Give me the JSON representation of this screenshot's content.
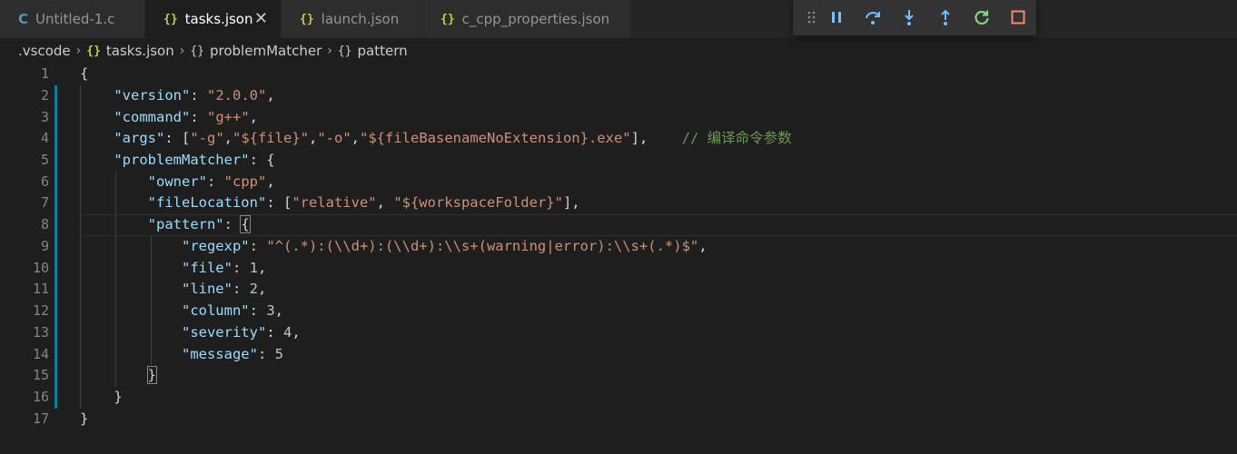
{
  "tabs": [
    {
      "icon": "C",
      "label": "Untitled-1.c"
    },
    {
      "icon": "{}",
      "label": "tasks.json",
      "close": "✕"
    },
    {
      "icon": "{}",
      "label": "launch.json"
    },
    {
      "icon": "{}",
      "label": "c_cpp_properties.json"
    }
  ],
  "debug_toolbar": {
    "icons": [
      "drag-handle-icon",
      "pause-icon",
      "step-over-icon",
      "step-into-icon",
      "step-out-icon",
      "restart-icon",
      "stop-icon"
    ],
    "colors": {
      "blue": "#75beff",
      "green": "#89d185",
      "red": "#f48771"
    }
  },
  "breadcrumb": {
    "folder": ".vscode",
    "file_icon": "{}",
    "file": "tasks.json",
    "obj_icon": "{}",
    "item1": "problemMatcher",
    "item2": "pattern",
    "separator": "›"
  },
  "editor": {
    "line_numbers": [
      "1",
      "2",
      "3",
      "4",
      "5",
      "6",
      "7",
      "8",
      "9",
      "10",
      "11",
      "12",
      "13",
      "14",
      "15",
      "16",
      "17"
    ],
    "lines": {
      "l1_brace": "{",
      "l2_key": "\"version\"",
      "l2_val": "\"2.0.0\"",
      "l3_key": "\"command\"",
      "l3_val": "\"g++\"",
      "l4_key": "\"args\"",
      "l4_a1": "\"-g\"",
      "l4_a2": "\"${file}\"",
      "l4_a3": "\"-o\"",
      "l4_a4": "\"${fileBasenameNoExtension}.exe\"",
      "l4_comment": "// 编译命令参数",
      "l5_key": "\"problemMatcher\"",
      "l6_key": "\"owner\"",
      "l6_val": "\"cpp\"",
      "l7_key": "\"fileLocation\"",
      "l7_a1": "\"relative\"",
      "l7_a2": "\"${workspaceFolder}\"",
      "l8_key": "\"pattern\"",
      "l9_key": "\"regexp\"",
      "l9_val": "\"^(.*):(\\\\d+):(\\\\d+):\\\\s+(warning|error):\\\\s+(.*)$\"",
      "l10_key": "\"file\"",
      "l10_val": "1",
      "l11_key": "\"line\"",
      "l11_val": "2",
      "l12_key": "\"column\"",
      "l12_val": "3",
      "l13_key": "\"severity\"",
      "l13_val": "4",
      "l14_key": "\"message\"",
      "l14_val": "5",
      "l15_brace": "}",
      "l16_brace": "}",
      "l17_brace": "}"
    },
    "colors": {
      "key": "#9cdcfe",
      "string": "#ce9178",
      "number": "#b5cea8",
      "comment": "#6a9955"
    }
  }
}
